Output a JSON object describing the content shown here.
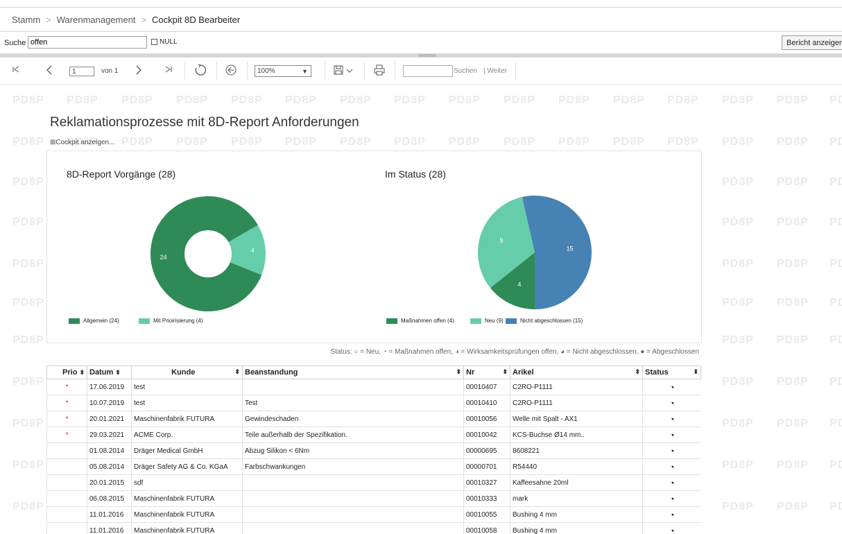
{
  "breadcrumb": {
    "items": [
      "Stamm",
      "Warenmanagement",
      "Cockpit 8D Bearbeiter"
    ]
  },
  "search": {
    "label": "Suche",
    "value": "offen",
    "null_label": "NULL",
    "report_button": "Bericht anzeigen"
  },
  "toolbar": {
    "page": "1",
    "of": "von 1",
    "zoom": "100%",
    "find_label": "Suchen",
    "next_label": "| Weiter"
  },
  "report": {
    "watermark": "PD8P",
    "title": "Reklamationsprozesse mit 8D-Report Anforderungen",
    "expander": "⊞Cockpit anzeigen..."
  },
  "chart_data": [
    {
      "type": "pie",
      "title": "8D-Report Vorgänge (28)",
      "donut": true,
      "categories": [
        "Allgemein (24)",
        "Mit Prioirisierung (4)"
      ],
      "values": [
        24,
        4
      ],
      "colors": [
        "#2e8b57",
        "#66cdaa"
      ]
    },
    {
      "type": "pie",
      "title": "Im Status (28)",
      "donut": false,
      "categories": [
        "Maßnahmen offen (4)",
        "Neu (9)",
        "Nicht abgeschlossen (15)"
      ],
      "values": [
        4,
        9,
        15
      ],
      "colors": [
        "#2e8b57",
        "#66cdaa",
        "#4682b4"
      ]
    }
  ],
  "status_legend": "Status: ○ = Neu, ◔ = Maßnahmen offen, ◑ = Wirksamkeitsprüfungen offen, ◕ = Nicht abgeschlossen, ● = Abgeschlossen",
  "table": {
    "headers": [
      "Prio",
      "Datum",
      "Kunde",
      "Beanstandung",
      "Nr",
      "Arikel",
      "Status"
    ],
    "rows": [
      {
        "prio": "*",
        "datum": "17.06.2019",
        "kunde": "test",
        "beanstandung": "",
        "nr": "00010407",
        "artikel": "C2RO-P1111",
        "status": "◔"
      },
      {
        "prio": "*",
        "datum": "10.07.2019",
        "kunde": "test",
        "beanstandung": "Test",
        "nr": "00010410",
        "artikel": "C2RO-P1111",
        "status": "◔"
      },
      {
        "prio": "*",
        "datum": "20.01.2021",
        "kunde": "Maschinenfabrik FUTURA",
        "beanstandung": "Gewindeschaden",
        "nr": "00010056",
        "artikel": "Welle mit Spalt - AX1",
        "status": "◔"
      },
      {
        "prio": "*",
        "datum": "29.03.2021",
        "kunde": "ACME Corp.",
        "beanstandung": "Teile außerhalb der Spezifikation.",
        "nr": "00010042",
        "artikel": "KCS-Buchse Ø14 mm..",
        "status": "◔"
      },
      {
        "prio": "",
        "datum": "01.08.2014",
        "kunde": "Dräger Medical GmbH",
        "beanstandung": "Abzug Silikon < 6Nm",
        "nr": "00000695",
        "artikel": "8608221",
        "status": "◔"
      },
      {
        "prio": "",
        "datum": "05.08.2014",
        "kunde": "Dräger Safety AG & Co. KGaA",
        "beanstandung": "Farbschwankungen",
        "nr": "00000701",
        "artikel": "R54440",
        "status": "◔"
      },
      {
        "prio": "",
        "datum": "20.01.2015",
        "kunde": "sdf",
        "beanstandung": "",
        "nr": "00010327",
        "artikel": "Kaffeesahne 20ml",
        "status": "◔"
      },
      {
        "prio": "",
        "datum": "06.08.2015",
        "kunde": "Maschinenfabrik FUTURA",
        "beanstandung": "",
        "nr": "00010333",
        "artikel": "mark",
        "status": "◔"
      },
      {
        "prio": "",
        "datum": "11.01.2016",
        "kunde": "Maschinenfabrik FUTURA",
        "beanstandung": "",
        "nr": "00010055",
        "artikel": "Bushing 4 mm",
        "status": "◔"
      },
      {
        "prio": "",
        "datum": "11.01.2016",
        "kunde": "Maschinenfabrik FUTURA",
        "beanstandung": "",
        "nr": "00010058",
        "artikel": "Bushing 4 mm",
        "status": "◔"
      }
    ]
  }
}
